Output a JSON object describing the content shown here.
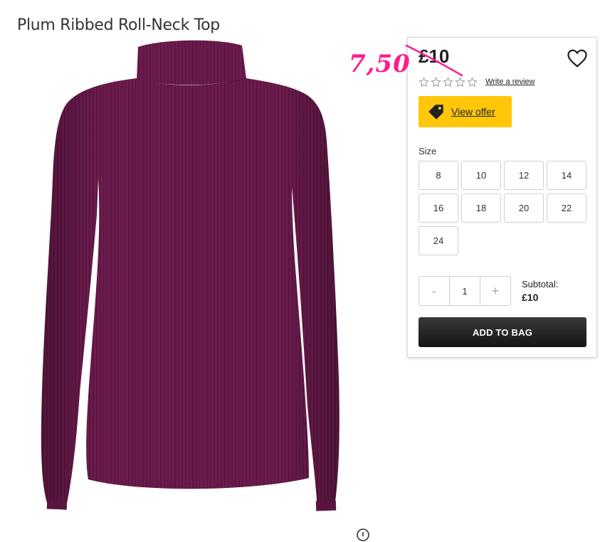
{
  "product": {
    "title": "Plum Ribbed Roll-Neck Top"
  },
  "pricing": {
    "price": "£10",
    "annotated_sale_price": "7,50"
  },
  "reviews": {
    "rating_stars": 0,
    "max_stars": 5,
    "write_review_label": "Write a review"
  },
  "offer": {
    "label": "View offer",
    "color": "#ffc60a"
  },
  "size": {
    "label": "Size",
    "options": [
      "8",
      "10",
      "12",
      "14",
      "16",
      "18",
      "20",
      "22",
      "24"
    ]
  },
  "quantity": {
    "minus_label": "-",
    "value": "1",
    "plus_label": "+"
  },
  "subtotal": {
    "label": "Subtotal:",
    "value": "£10"
  },
  "cart": {
    "add_label": "ADD TO BAG"
  },
  "colors": {
    "annotation_pink": "#ff1d8e",
    "garment_plum": "#6b1a4c"
  },
  "icons": {
    "wishlist": "heart-icon",
    "offer_tag": "tag-icon",
    "zoom": "zoom-icon"
  }
}
